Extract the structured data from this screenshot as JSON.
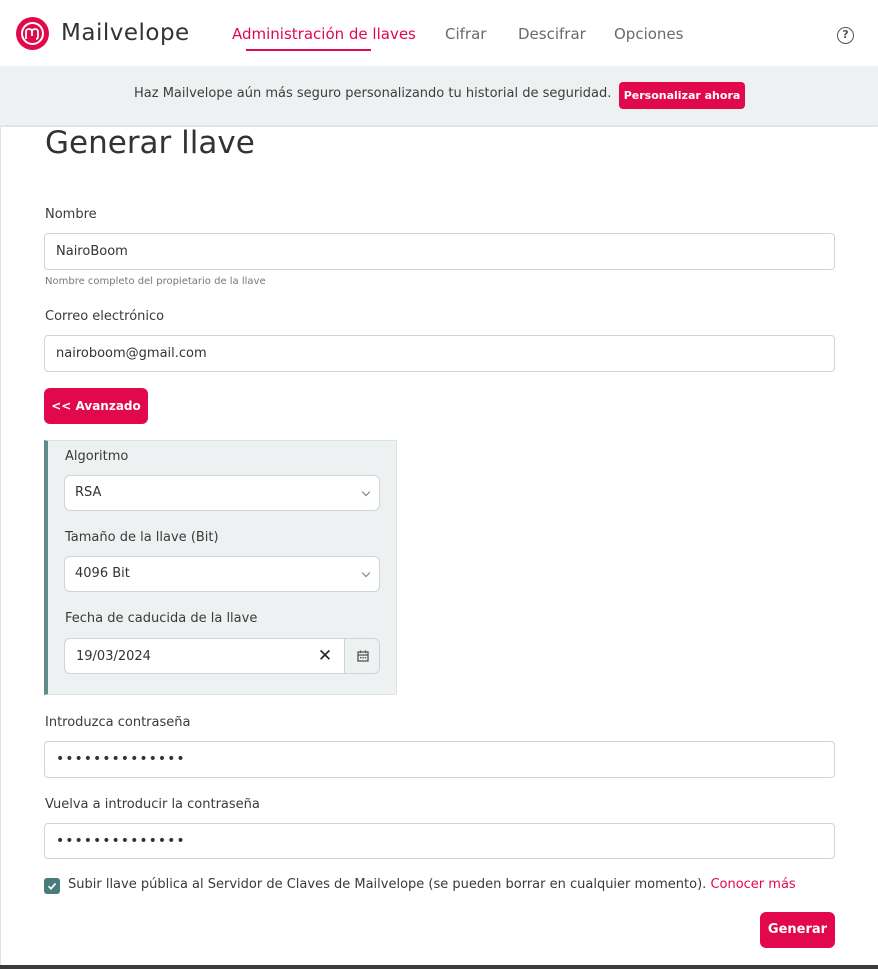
{
  "brand": {
    "name": "Mailvelope",
    "accent": "#e2084d"
  },
  "nav": {
    "items": [
      {
        "label": "Administración de llaves",
        "active": true
      },
      {
        "label": "Cifrar",
        "active": false
      },
      {
        "label": "Descifrar",
        "active": false
      },
      {
        "label": "Opciones",
        "active": false
      }
    ],
    "help_icon": "question-circle-icon"
  },
  "banner": {
    "text": "Haz Mailvelope aún más seguro personalizando tu historial de seguridad.",
    "button": "Personalizar ahora"
  },
  "form": {
    "title": "Generar llave",
    "name": {
      "label": "Nombre",
      "value": "NairoBoom",
      "hint": "Nombre completo del propietario de la llave"
    },
    "email": {
      "label": "Correo electrónico",
      "value": "nairoboom@gmail.com"
    },
    "advanced_button": "<< Avanzado",
    "advanced": {
      "algorithm": {
        "label": "Algoritmo",
        "value": "RSA"
      },
      "key_size": {
        "label": "Tamaño de la llave (Bit)",
        "value": "4096 Bit"
      },
      "expiry": {
        "label": "Fecha de caducida de la llave",
        "value": "19/03/2024",
        "clear": "✕",
        "calendar_icon": "calendar-icon"
      }
    },
    "password": {
      "label": "Introduzca contraseña",
      "value": "••••••••••••••"
    },
    "password_confirm": {
      "label": "Vuelva a introducir la contraseña",
      "value": "••••••••••••••"
    },
    "upload": {
      "checked": true,
      "text": "Subir llave pública al Servidor de Claves de Mailvelope (se pueden borrar en cualquier momento).",
      "link": "Conocer más"
    },
    "submit": "Generar"
  }
}
